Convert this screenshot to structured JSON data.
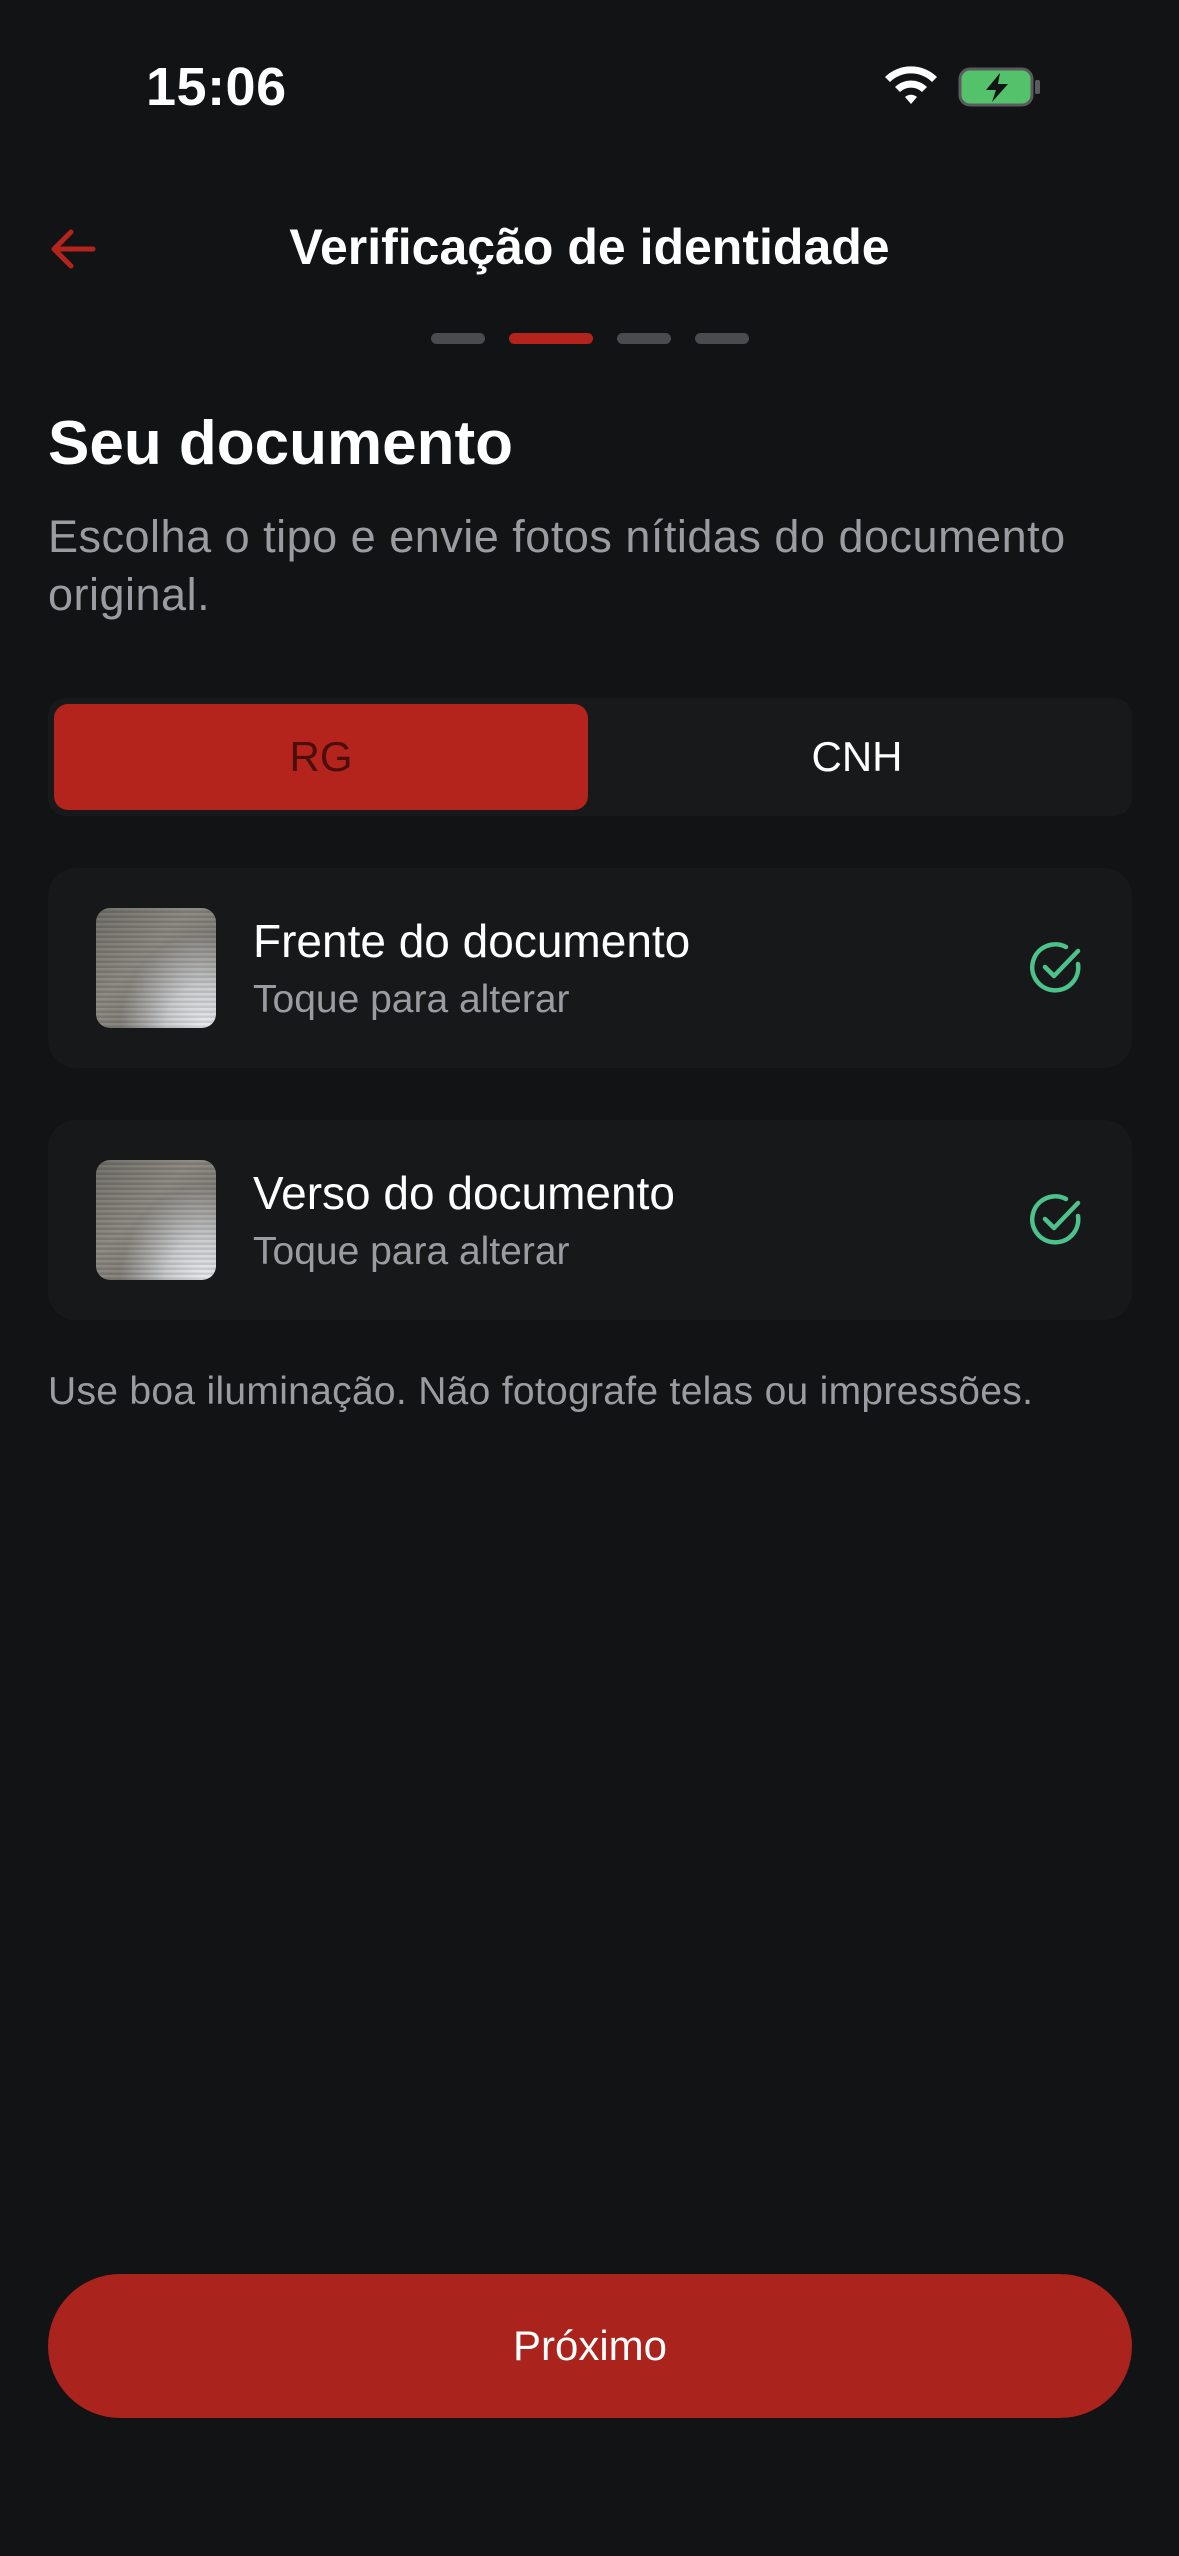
{
  "status_bar": {
    "time": "15:06",
    "icons": [
      "wifi-icon",
      "battery-charging-icon"
    ]
  },
  "header": {
    "title": "Verificação de identidade",
    "back_icon": "arrow-left-icon"
  },
  "progress": {
    "total_steps": 4,
    "current_step": 2
  },
  "section": {
    "title": "Seu documento",
    "subtitle": "Escolha o tipo e envie fotos nítidas do documento original."
  },
  "document_type": {
    "options": [
      "RG",
      "CNH"
    ],
    "selected": "RG"
  },
  "documents": [
    {
      "title": "Frente do documento",
      "subtitle": "Toque para alterar",
      "status_icon": "check-circle-icon"
    },
    {
      "title": "Verso do documento",
      "subtitle": "Toque para alterar",
      "status_icon": "check-circle-icon"
    }
  ],
  "hint": "Use boa iluminação. Não fotografe telas ou impressões.",
  "next_button": "Próximo",
  "colors": {
    "background": "#121315",
    "accent": "#b5241c",
    "success": "#4cc38a",
    "muted_text": "#9b9ca1"
  }
}
